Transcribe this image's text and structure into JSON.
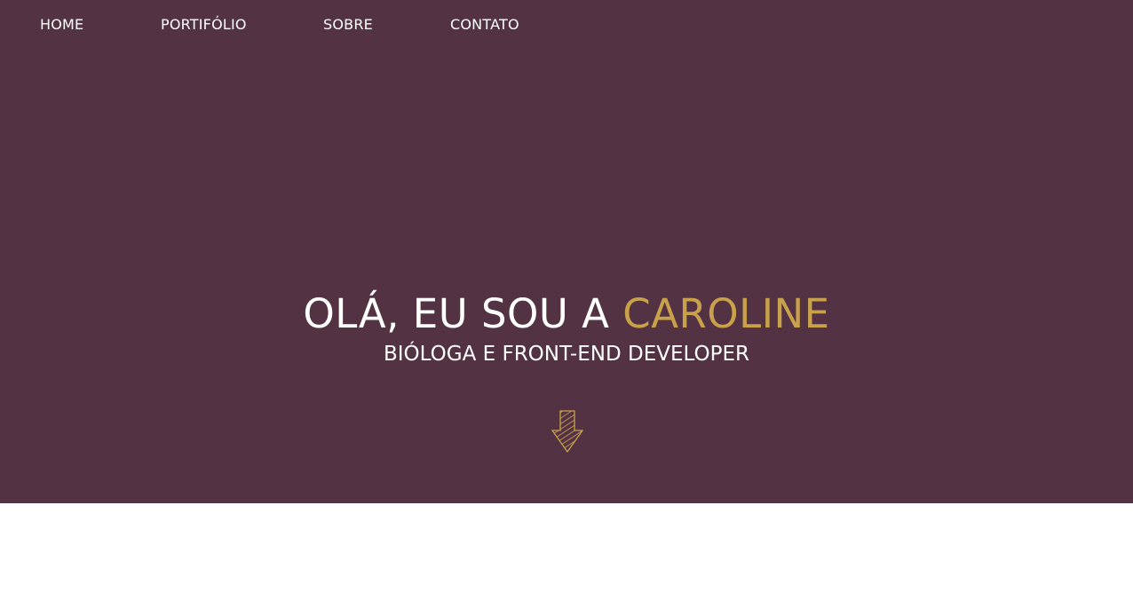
{
  "nav": {
    "items": [
      {
        "label": "HOME"
      },
      {
        "label": "PORTIFÓLIO"
      },
      {
        "label": "SOBRE"
      },
      {
        "label": "CONTATO"
      }
    ]
  },
  "hero": {
    "greeting": "OLÁ, EU SOU A",
    "name": "CAROLINE",
    "subtitle": "BIÓLOGA E FRONT-END DEVELOPER",
    "scroll_icon": "down-arrow-icon"
  },
  "colors": {
    "hero_background": "#523243",
    "accent": "#c9a14a",
    "text": "#ffffff",
    "page_background": "#ffffff"
  }
}
